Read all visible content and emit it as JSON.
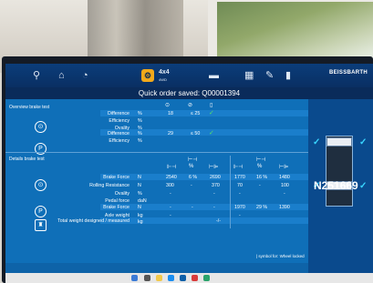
{
  "header": {
    "quick_order_text": "Quick order saved: Q00001394",
    "brand": "BEISSBARTH",
    "active_tab_label": "4x4",
    "active_tab_sublabel": "4WD"
  },
  "sections": {
    "service_brake": "Overview brake test",
    "details": "Details brake test"
  },
  "top_table": {
    "col_headers": [
      "⊙",
      "⊘",
      "▯"
    ],
    "rows": [
      {
        "label": "Difference",
        "unit": "%",
        "v1": "18",
        "v2": "≤ 25",
        "check": "✓"
      },
      {
        "label": "Efficiency",
        "unit": "%",
        "v1": "",
        "v2": "",
        "check": ""
      },
      {
        "label": "Ovality",
        "unit": "%",
        "v1": "",
        "v2": "",
        "check": ""
      },
      {
        "label": "Difference",
        "unit": "%",
        "v1": "29",
        "v2": "≤ 50",
        "check": "✓"
      },
      {
        "label": "Efficiency",
        "unit": "%",
        "v1": "",
        "v2": "",
        "check": ""
      }
    ]
  },
  "bottom_table": {
    "rows": [
      {
        "label": "Brake Force",
        "unit": "N",
        "c1": "2540",
        "c2": "6 %",
        "c3": "2690",
        "c4": "1770",
        "c5": "16 %",
        "c6": "1480"
      },
      {
        "label": "Rolling Resistance",
        "unit": "N",
        "c1": "300",
        "c2": "-",
        "c3": "370",
        "c4": "70",
        "c5": "-",
        "c6": "100"
      },
      {
        "label": "Ovality",
        "unit": "%",
        "c1": "-",
        "c2": "",
        "c3": "-",
        "c4": "-",
        "c5": "",
        "c6": "-"
      },
      {
        "label": "Pedal force",
        "unit": "daN",
        "c1": "",
        "c2": "",
        "c3": "",
        "c4": "",
        "c5": "",
        "c6": ""
      },
      {
        "label": "Brake Force",
        "unit": "N",
        "c1": "-",
        "c2": "-",
        "c3": "-",
        "c4": "1970",
        "c5": "29 %",
        "c6": "1390"
      },
      {
        "label": "Axle weight",
        "unit": "kg",
        "c1": "-",
        "c2": "",
        "c3": "",
        "c4": "-",
        "c5": "",
        "c6": ""
      },
      {
        "label": "Total weight designed / measured",
        "unit": "kg",
        "c1": "",
        "c2": "",
        "c3": "-/-",
        "c4": "",
        "c5": "",
        "c6": ""
      }
    ]
  },
  "footnote": "| symbol for: Wheel locked",
  "plate": "N251669"
}
